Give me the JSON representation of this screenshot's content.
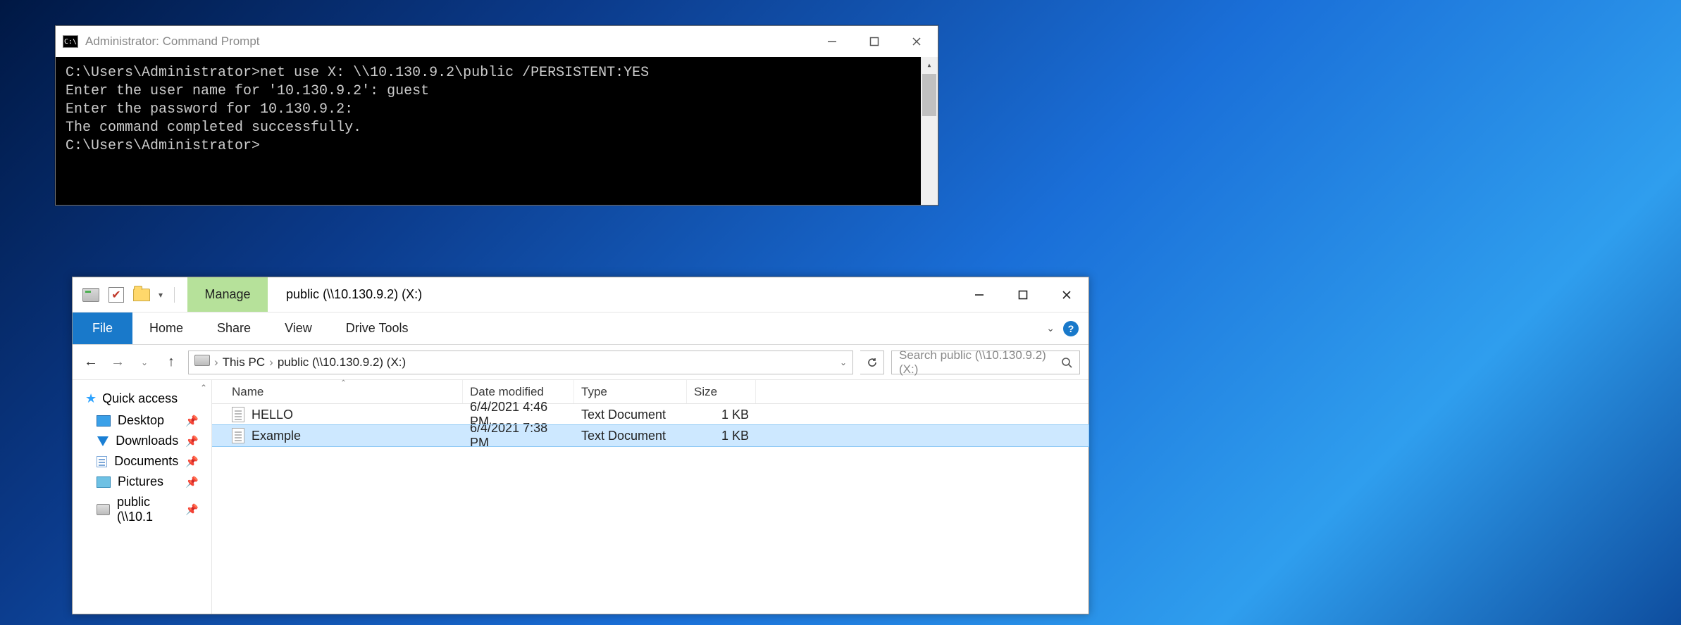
{
  "cmd": {
    "title": "Administrator: Command Prompt",
    "lines": [
      "C:\\Users\\Administrator>net use X: \\\\10.130.9.2\\public /PERSISTENT:YES",
      "Enter the user name for '10.130.9.2': guest",
      "Enter the password for 10.130.9.2:",
      "The command completed successfully.",
      "",
      "",
      "C:\\Users\\Administrator>"
    ]
  },
  "explorer": {
    "manage_label": "Manage",
    "title": "public (\\\\10.130.9.2) (X:)",
    "ribbon": {
      "file": "File",
      "home": "Home",
      "share": "Share",
      "view": "View",
      "tools": "Drive Tools"
    },
    "breadcrumb": {
      "root": "This PC",
      "loc": "public (\\\\10.130.9.2) (X:)"
    },
    "search_placeholder": "Search public (\\\\10.130.9.2) (X:)",
    "nav": {
      "quick": "Quick access",
      "desktop": "Desktop",
      "downloads": "Downloads",
      "documents": "Documents",
      "pictures": "Pictures",
      "public": "public (\\\\10.1"
    },
    "cols": {
      "name": "Name",
      "date": "Date modified",
      "type": "Type",
      "size": "Size"
    },
    "files": [
      {
        "name": "HELLO",
        "date": "6/4/2021 4:46 PM",
        "type": "Text Document",
        "size": "1 KB"
      },
      {
        "name": "Example",
        "date": "6/4/2021 7:38 PM",
        "type": "Text Document",
        "size": "1 KB"
      }
    ]
  }
}
